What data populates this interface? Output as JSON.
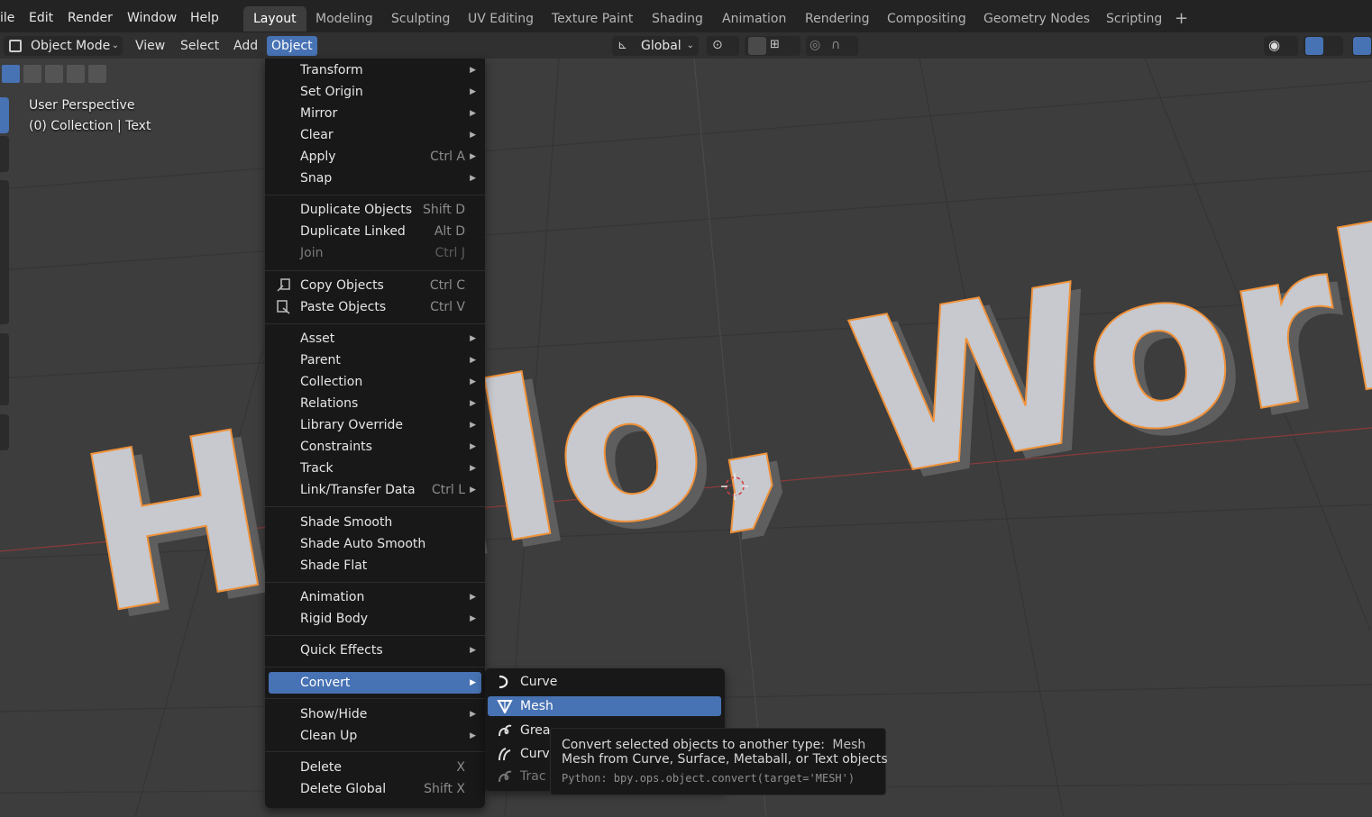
{
  "topbar": {
    "menus": [
      "ile",
      "Edit",
      "Render",
      "Window",
      "Help"
    ],
    "workspaces": [
      "Layout",
      "Modeling",
      "Sculpting",
      "UV Editing",
      "Texture Paint",
      "Shading",
      "Animation",
      "Rendering",
      "Compositing",
      "Geometry Nodes",
      "Scripting"
    ],
    "active_workspace": "Layout",
    "add_workspace": "+"
  },
  "header": {
    "mode": "Object Mode",
    "menus": [
      "View",
      "Select",
      "Add",
      "Object"
    ],
    "active_menu": "Object",
    "transform_orientation": "Global"
  },
  "viewport": {
    "perspective": "User Perspective",
    "collection": "(0) Collection | Text",
    "scene_text": "Hello, World!"
  },
  "object_menu": {
    "items": [
      {
        "label": "Transform",
        "submenu": true
      },
      {
        "label": "Set Origin",
        "submenu": true
      },
      {
        "label": "Mirror",
        "submenu": true
      },
      {
        "label": "Clear",
        "submenu": true
      },
      {
        "label": "Apply",
        "shortcut": "Ctrl A",
        "submenu": true
      },
      {
        "label": "Snap",
        "submenu": true
      },
      {
        "label": "Duplicate Objects",
        "shortcut": "Shift D"
      },
      {
        "label": "Duplicate Linked",
        "shortcut": "Alt D"
      },
      {
        "label": "Join",
        "shortcut": "Ctrl J",
        "disabled": true
      },
      {
        "label": "Copy Objects",
        "shortcut": "Ctrl C",
        "icon": "copy-icon"
      },
      {
        "label": "Paste Objects",
        "shortcut": "Ctrl V",
        "icon": "paste-icon"
      },
      {
        "label": "Asset",
        "submenu": true
      },
      {
        "label": "Parent",
        "submenu": true
      },
      {
        "label": "Collection",
        "submenu": true
      },
      {
        "label": "Relations",
        "submenu": true
      },
      {
        "label": "Library Override",
        "submenu": true
      },
      {
        "label": "Constraints",
        "submenu": true
      },
      {
        "label": "Track",
        "submenu": true
      },
      {
        "label": "Link/Transfer Data",
        "shortcut": "Ctrl L",
        "submenu": true
      },
      {
        "label": "Shade Smooth"
      },
      {
        "label": "Shade Auto Smooth"
      },
      {
        "label": "Shade Flat"
      },
      {
        "label": "Animation",
        "submenu": true
      },
      {
        "label": "Rigid Body",
        "submenu": true
      },
      {
        "label": "Quick Effects",
        "submenu": true
      },
      {
        "label": "Convert",
        "submenu": true,
        "highlighted": true
      },
      {
        "label": "Show/Hide",
        "submenu": true
      },
      {
        "label": "Clean Up",
        "submenu": true
      },
      {
        "label": "Delete",
        "shortcut": "X"
      },
      {
        "label": "Delete Global",
        "shortcut": "Shift X"
      }
    ]
  },
  "convert_submenu": {
    "items": [
      {
        "label": "Curve",
        "icon": "curve-icon"
      },
      {
        "label": "Mesh",
        "icon": "mesh-icon",
        "highlighted": true
      },
      {
        "label": "Grea",
        "icon": "grease-pencil-icon"
      },
      {
        "label": "Curv",
        "icon": "curves-icon"
      },
      {
        "label": "Trac",
        "icon": "trace-icon",
        "disabled": true
      }
    ]
  },
  "tooltip": {
    "title": "Convert selected objects to another type:",
    "title_value": "Mesh",
    "description": "Mesh from Curve, Surface, Metaball, or Text objects",
    "python": "Python: bpy.ops.object.convert(target='MESH')"
  },
  "colors": {
    "accent": "#4772b3",
    "menu_bg": "#181818",
    "viewport_bg": "#3d3d3d",
    "selection_outline": "#f0923a"
  }
}
